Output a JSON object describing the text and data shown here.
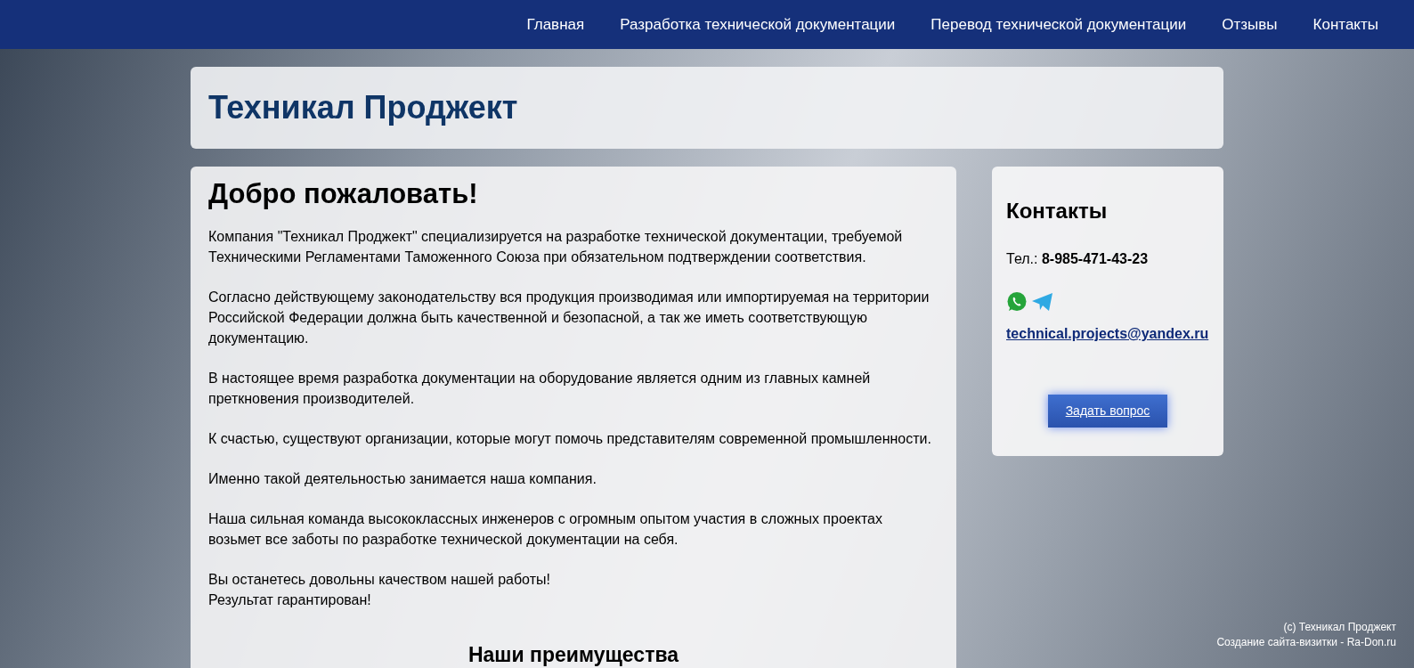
{
  "nav": {
    "items": [
      {
        "label": "Главная"
      },
      {
        "label": "Разработка технической документации"
      },
      {
        "label": "Перевод технической документации"
      },
      {
        "label": "Отзывы"
      },
      {
        "label": "Контакты"
      }
    ]
  },
  "header": {
    "title": "Техникал Проджект"
  },
  "main": {
    "title": "Добро пожаловать!",
    "paragraphs": [
      [
        "Компания \"Техникал Проджект\" специализируется на разработке технической документации, требуемой Техническими Регламентами Таможенного Союза при обязательном подтверждении соответствия."
      ],
      [
        "Согласно действующему законодательству вся продукция производимая или импортируемая на территории Российской Федерации должна быть качественной и безопасной, а так же иметь соответствующую документацию."
      ],
      [
        "В настоящее время разработка документации на оборудование является одним из главных камней преткновения производителей."
      ],
      [
        "К счастью, существуют организации, которые могут помочь представителям современной промышленности."
      ],
      [
        "Именно такой деятельностью занимается наша компания."
      ],
      [
        "Наша сильная команда высококлассных инженеров с огромным опытом участия в сложных проектах возьмет все заботы по разработке технической документации на себя."
      ],
      [
        "Вы останетесь довольны качеством нашей работы!",
        "Результат гарантирован!"
      ]
    ],
    "subtitle": "Наши преимущества"
  },
  "contacts": {
    "title": "Контакты",
    "phone": "Тел.: **8-985-471-43-23**",
    "email": "technical.projects@yandex.ru",
    "button": "Задать вопрос"
  },
  "footer": {
    "lines": [
      "(c) Техникал Проджект",
      "Создание сайта-визитки - Ra-Don.ru"
    ]
  }
}
